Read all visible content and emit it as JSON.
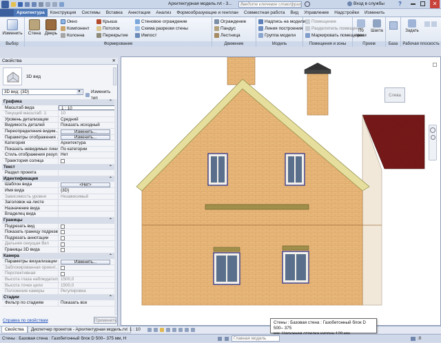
{
  "titlebar": {
    "title": "Архитектурная модель.rvt - 3...",
    "search_placeholder": "Введите ключевое слово/фразу",
    "login": "Вход в службы",
    "help": "?"
  },
  "tabs": [
    "Архитектура",
    "Конструкция",
    "Системы",
    "Вставка",
    "Аннотации",
    "Анализ",
    "Формообразующие и генплан",
    "Совместная работа",
    "Вид",
    "Управление",
    "Надстройки",
    "Изменить"
  ],
  "ribbon": {
    "modify": "Изменить",
    "select": "Выбор",
    "wall": "Стена",
    "door": "Дверь",
    "window": "Окно",
    "component": "Компонент",
    "column": "Колонна",
    "roof": "Крыша",
    "ceiling": "Потолок",
    "floor": "Перекрытие",
    "curtain_wall": "Стеновое ограждение",
    "curtain_grid": "Схема разрезки стены",
    "mullion": "Импост",
    "build_label": "Формирование",
    "railing": "Ограждение",
    "ramp": "Пандус",
    "stair": "Лестница",
    "circulation_label": "Движение",
    "model_text": "Надпись на модели",
    "model_line": "Линия построения",
    "model_group": "Группа модели",
    "model_label": "Модель",
    "room": "Помещение",
    "room_sep": "Разделитель помещений",
    "tag_room": "Маркировать помещение",
    "room_label": "Помещения и зоны",
    "by_face": "По грани",
    "shaft": "Шахта",
    "opening_label": "Проем",
    "datum_label": "База",
    "set": "Задать",
    "workplane_label": "Рабочая плоскость"
  },
  "properties": {
    "header": "Свойства",
    "type_name": "3D вид",
    "selector": "3D вид: {3D}",
    "edit_type": "Изменить тип",
    "sections": [
      {
        "title": "Графика",
        "rows": [
          {
            "k": "Масштаб вида",
            "v": "1 : 10",
            "kind": "box"
          },
          {
            "k": "Текущий масштаб: 1:",
            "v": "10",
            "kind": "dis"
          },
          {
            "k": "Уровень детализации",
            "v": "Средний"
          },
          {
            "k": "Видимость деталей",
            "v": "Показать исходный"
          },
          {
            "k": "Переопределения видим...",
            "v": "Изменить...",
            "kind": "btn"
          },
          {
            "k": "Параметры отображения ...",
            "v": "Изменить...",
            "kind": "btn"
          },
          {
            "k": "Категория",
            "v": "Архитектура"
          },
          {
            "k": "Показать невидимые линии",
            "v": "По категории"
          },
          {
            "k": "Стиль отображения резул...",
            "v": "Нет"
          },
          {
            "k": "Траектория солнца",
            "v": "",
            "kind": "chk"
          }
        ]
      },
      {
        "title": "Текст",
        "rows": [
          {
            "k": "Раздел проекта",
            "v": ""
          }
        ]
      },
      {
        "title": "Идентификация",
        "rows": [
          {
            "k": "Шаблон вида",
            "v": "<Нет>",
            "kind": "btn"
          },
          {
            "k": "Имя вида",
            "v": "{3D}"
          },
          {
            "k": "Зависимость уровня",
            "v": "Независимый",
            "kind": "dis"
          },
          {
            "k": "Заголовок на листе",
            "v": ""
          },
          {
            "k": "Назначение вида",
            "v": ""
          },
          {
            "k": "Владелец вида",
            "v": ""
          }
        ]
      },
      {
        "title": "Границы",
        "rows": [
          {
            "k": "Подрезать вид",
            "v": "",
            "kind": "chk"
          },
          {
            "k": "Показать границу подрезки",
            "v": "",
            "kind": "chk"
          },
          {
            "k": "Подрезать аннотации",
            "v": "",
            "kind": "chk"
          },
          {
            "k": "Дальняя секущая Вкл",
            "v": "",
            "kind": "chkdis"
          },
          {
            "k": "Границы 3D вида",
            "v": "",
            "kind": "chk"
          }
        ]
      },
      {
        "title": "Камера",
        "rows": [
          {
            "k": "Параметры визуализации",
            "v": "Изменить...",
            "kind": "btn"
          },
          {
            "k": "Заблокированная ориент...",
            "v": "",
            "kind": "chkdis"
          },
          {
            "k": "Перспективная",
            "v": "",
            "kind": "chkdis"
          },
          {
            "k": "Высота глаза наблюдателя",
            "v": "1500,0",
            "kind": "dis"
          },
          {
            "k": "Высота точки цели",
            "v": "1500,0",
            "kind": "dis"
          },
          {
            "k": "Положение камеры",
            "v": "Регулировка",
            "kind": "dis"
          }
        ]
      },
      {
        "title": "Стадии",
        "rows": [
          {
            "k": "Фильтр по стадиям",
            "v": "Показать все"
          }
        ]
      }
    ],
    "help_link": "Справка по свойствам",
    "apply": "Применить"
  },
  "viewcube": {
    "face": "Слева"
  },
  "canvas": {
    "scale": "1 : 10"
  },
  "bottom_tabs": [
    "Свойства",
    "Диспетчер проектов - Архитектурная модель.rvt"
  ],
  "status": {
    "text": "Стены : Базовая стена : Газобетонный блок D 500– 375 мм, Н",
    "model": "Главная модель",
    "zero": ":0"
  },
  "tooltip": {
    "line1": "Стены : Базовая стена : Газобетонный блок D 500– 375",
    "line2": "мм, Наружная отделка кирпич 120 мм"
  },
  "colors": {
    "accent": "#4b76b7",
    "brick": "#e8b77a",
    "roof": "#7a1a1a",
    "trim": "#f0e7b8"
  }
}
